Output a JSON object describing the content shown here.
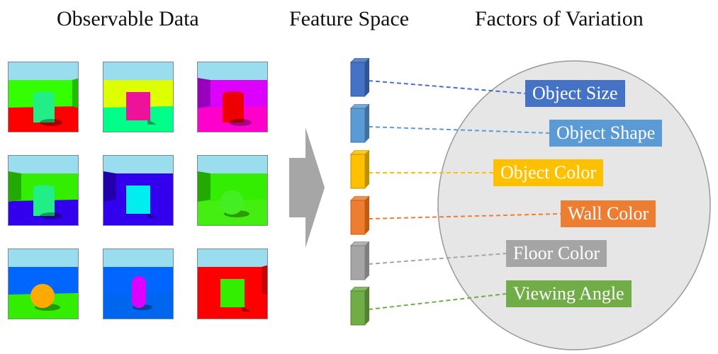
{
  "titles": {
    "observable": "Observable Data",
    "feature": "Feature Space",
    "factors": "Factors of Variation"
  },
  "scenes": [
    {
      "wall": "#33ff00",
      "wallSide": "#22bb00",
      "floor": "#ff0000",
      "object": "cylinder",
      "objectColor": "#22ee88",
      "side": "right"
    },
    {
      "wall": "#ddff00",
      "wallSide": "#bbdd00",
      "floor": "#00ff88",
      "object": "cube",
      "objectColor": "#ee1199",
      "side": "none"
    },
    {
      "wall": "#dd00ff",
      "wallSide": "#9900bb",
      "floor": "#ff00cc",
      "object": "cylinder",
      "objectColor": "#ee0000",
      "side": "left"
    },
    {
      "wall": "#33ee00",
      "wallSide": "#22aa00",
      "floor": "#3300ee",
      "object": "cylinder",
      "objectColor": "#22ee88",
      "side": "left"
    },
    {
      "wall": "#3300ee",
      "wallSide": "#2200aa",
      "floor": "#3300ee",
      "object": "cube",
      "objectColor": "#00eeee",
      "side": "left"
    },
    {
      "wall": "#33ee00",
      "wallSide": "#22aa00",
      "floor": "#44ee11",
      "object": "sphere",
      "objectColor": "#44ee22",
      "side": "left"
    },
    {
      "wall": "#0066ff",
      "wallSide": "#0055dd",
      "floor": "#33ee00",
      "object": "sphere",
      "objectColor": "#ffaa00",
      "side": "none"
    },
    {
      "wall": "#0066ff",
      "wallSide": "#0055dd",
      "floor": "#0066ee",
      "object": "capsule",
      "objectColor": "#dd00ff",
      "side": "none"
    },
    {
      "wall": "#ff0000",
      "wallSide": "#cc0000",
      "floor": "#ff0000",
      "object": "cube",
      "objectColor": "#33ee00",
      "side": "right"
    }
  ],
  "sky_color": "#99ddee",
  "arrow_color": "#a6a6a6",
  "circle": {
    "fill": "#e6e6e6",
    "stroke": "#999999"
  },
  "factors": [
    {
      "label": "Object Size",
      "color": "#4472c4",
      "dark": "#2f5597"
    },
    {
      "label": "Object Shape",
      "color": "#5b9bd5",
      "dark": "#41719c"
    },
    {
      "label": "Object Color",
      "color": "#ffc000",
      "dark": "#bf9000"
    },
    {
      "label": "Wall Color",
      "color": "#ed7d31",
      "dark": "#c55a11"
    },
    {
      "label": "Floor Color",
      "color": "#a5a5a5",
      "dark": "#7f7f7f"
    },
    {
      "label": "Viewing Angle",
      "color": "#70ad47",
      "dark": "#548235"
    }
  ]
}
